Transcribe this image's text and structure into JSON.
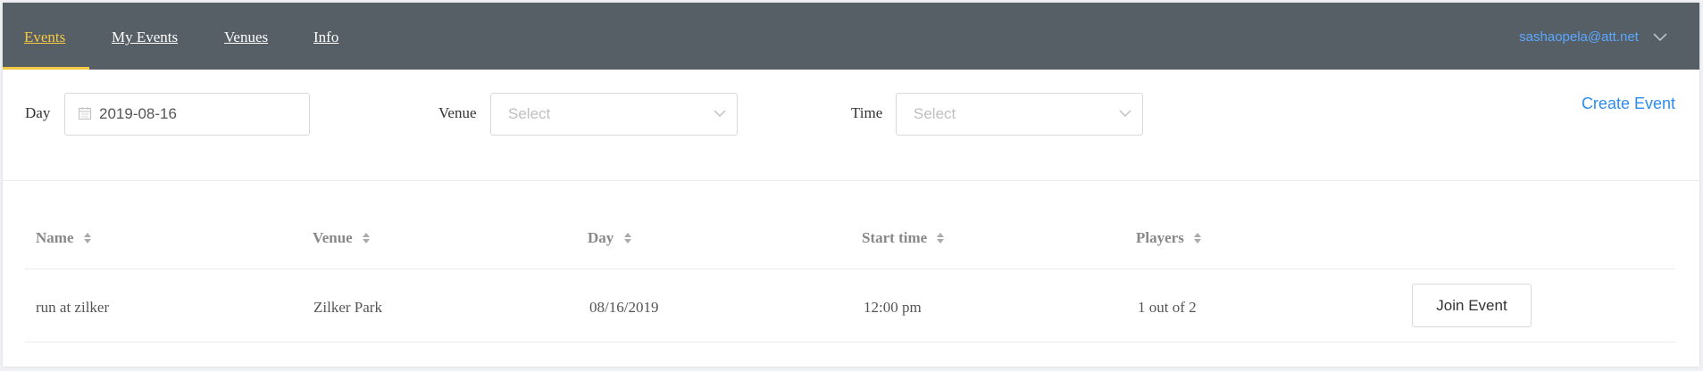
{
  "nav": {
    "items": [
      {
        "label": "Events",
        "active": true
      },
      {
        "label": "My Events",
        "active": false
      },
      {
        "label": "Venues",
        "active": false
      },
      {
        "label": "Info",
        "active": false
      }
    ],
    "user_email": "sashaopela@att.net",
    "user_menu_icon": "chevron-down-icon"
  },
  "filters": {
    "day_label": "Day",
    "day_value": "2019-08-16",
    "day_icon": "calendar-icon",
    "venue_label": "Venue",
    "venue_placeholder": "Select",
    "time_label": "Time",
    "time_placeholder": "Select"
  },
  "actions": {
    "create_event": "Create Event"
  },
  "table": {
    "columns": [
      "Name",
      "Venue",
      "Day",
      "Start time",
      "Players"
    ],
    "rows": [
      {
        "name": "run at zilker",
        "venue": "Zilker Park",
        "day": "08/16/2019",
        "start_time": "12:00 pm",
        "players": "1 out of 2",
        "action": "Join Event"
      }
    ]
  },
  "colors": {
    "navbar_bg": "#575f66",
    "nav_active": "#f5c944",
    "link_blue": "#2d8cf0",
    "user_email": "#5aa7ff"
  }
}
